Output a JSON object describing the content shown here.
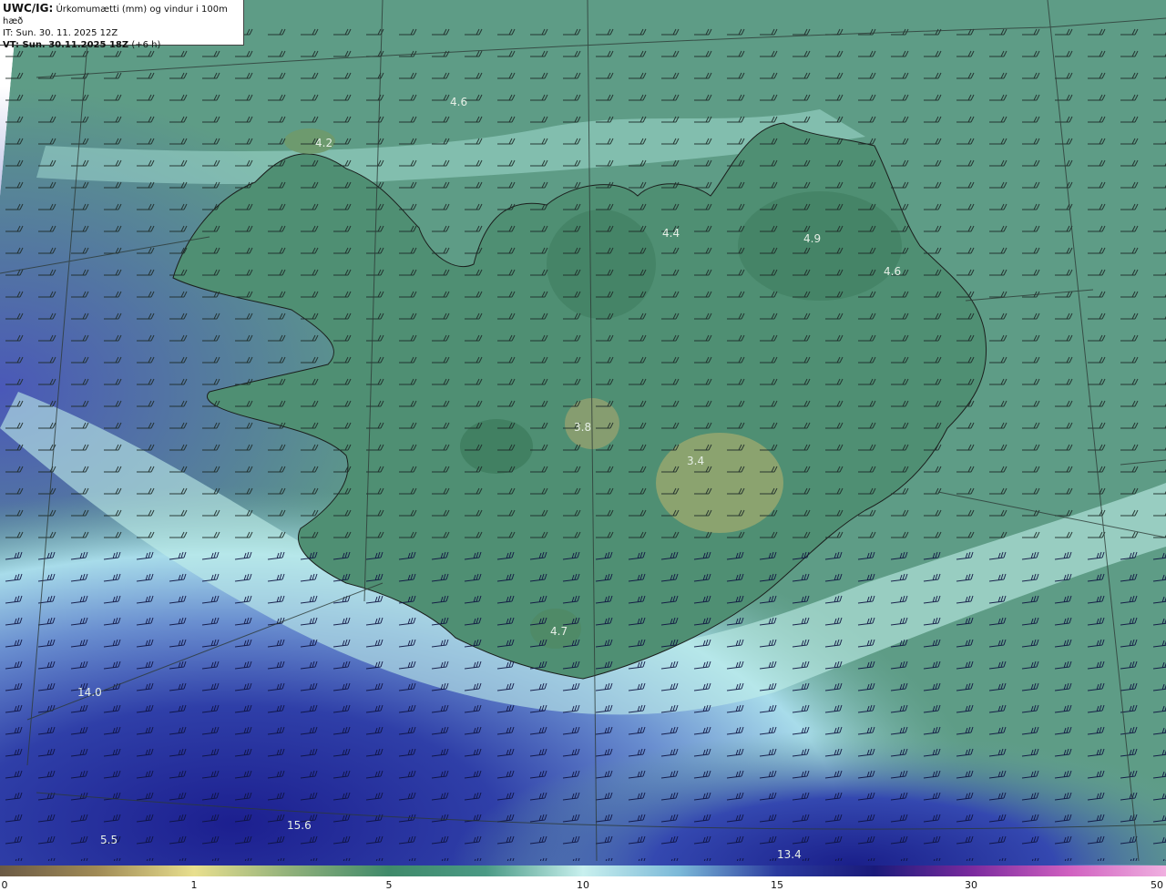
{
  "header": {
    "model": "UWC/IG:",
    "title": "Úrkomumætti (mm) og vindur i 100m hæð",
    "initial_time": "IT: Sun. 30. 11. 2025 12Z",
    "valid_time_label": "VT: Sun. 30.11.2025 18Z",
    "valid_time_offset": "(+6 h)"
  },
  "map_labels": [
    "4.6",
    "4.2",
    "4.4",
    "4.9",
    "4.6",
    "3.8",
    "3.4",
    "4.7",
    "14.0",
    "15.6",
    "5.5",
    "13.4"
  ],
  "colorbar": {
    "ticks": [
      "0",
      "1",
      "5",
      "10",
      "15",
      "30",
      "50"
    ],
    "colors": [
      "#6b5a45",
      "#a08a55",
      "#e8df8e",
      "#8fb07a",
      "#3f8a6a",
      "#4a9a85",
      "#c8f0ee",
      "#7ab8d8",
      "#2a3a9e",
      "#1a1a7a",
      "#7a2a9e",
      "#d060c0",
      "#f0b0e0"
    ]
  }
}
